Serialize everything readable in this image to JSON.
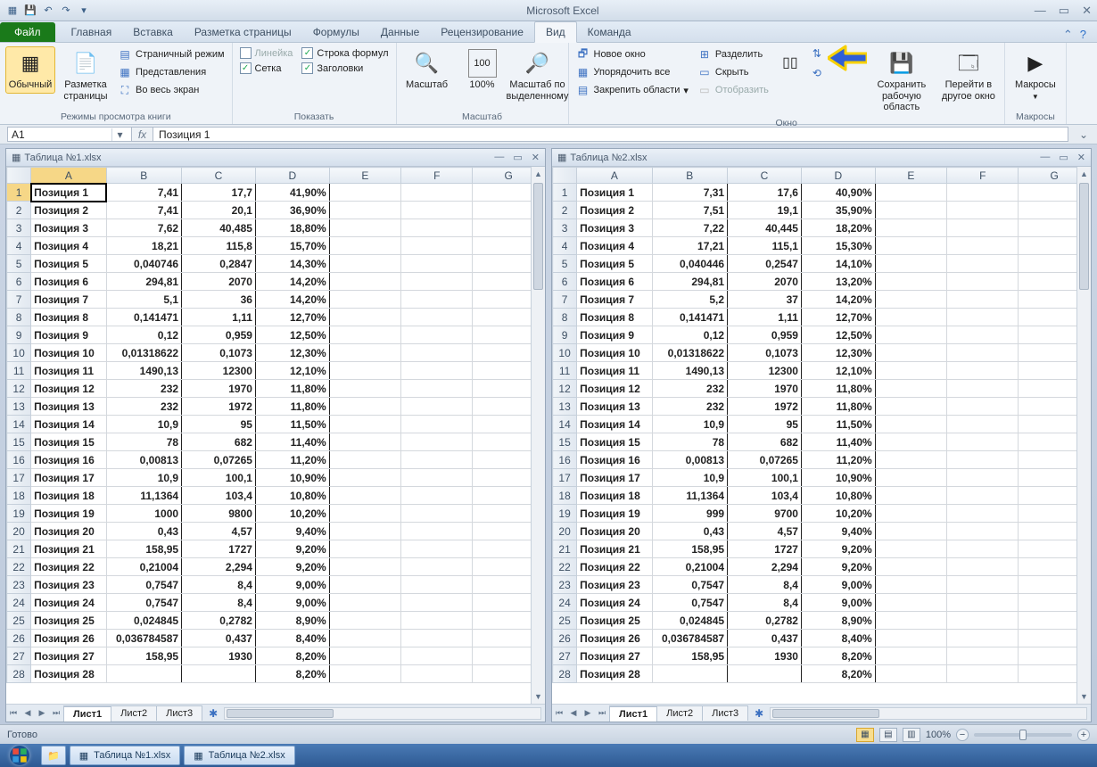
{
  "app_title": "Microsoft Excel",
  "quick_access": [
    "💾",
    "↶",
    "↷"
  ],
  "ribbon": {
    "file": "Файл",
    "tabs": [
      "Главная",
      "Вставка",
      "Разметка страницы",
      "Формулы",
      "Данные",
      "Рецензирование",
      "Вид",
      "Команда"
    ],
    "active_tab": "Вид",
    "groups": {
      "views": {
        "title": "Режимы просмотра книги",
        "normal": "Обычный",
        "page_layout": "Разметка\nстраницы",
        "page_break": "Страничный режим",
        "custom_views": "Представления",
        "fullscreen": "Во весь экран"
      },
      "show": {
        "title": "Показать",
        "ruler": "Линейка",
        "gridlines": "Сетка",
        "formula_bar": "Строка формул",
        "headings": "Заголовки"
      },
      "zoom": {
        "title": "Масштаб",
        "zoom": "Масштаб",
        "hundred": "100%",
        "selection": "Масштаб по\nвыделенному"
      },
      "window": {
        "title": "Окно",
        "new_window": "Новое окно",
        "arrange": "Упорядочить все",
        "freeze": "Закрепить области",
        "split": "Разделить",
        "hide": "Скрыть",
        "unhide": "Отобразить",
        "save_ws": "Сохранить\nрабочую область",
        "switch": "Перейти в\nдругое окно"
      },
      "macros": {
        "title": "Макросы",
        "label": "Макросы"
      }
    }
  },
  "namebox": "A1",
  "formula": "Позиция 1",
  "columns": [
    "A",
    "B",
    "C",
    "D",
    "E",
    "F",
    "G"
  ],
  "sheet_tabs": [
    "Лист1",
    "Лист2",
    "Лист3"
  ],
  "window1": {
    "title": "Таблица №1.xlsx",
    "rows": [
      [
        "Позиция 1",
        "7,41",
        "17,7",
        "41,90%"
      ],
      [
        "Позиция 2",
        "7,41",
        "20,1",
        "36,90%"
      ],
      [
        "Позиция 3",
        "7,62",
        "40,485",
        "18,80%"
      ],
      [
        "Позиция 4",
        "18,21",
        "115,8",
        "15,70%"
      ],
      [
        "Позиция 5",
        "0,040746",
        "0,2847",
        "14,30%"
      ],
      [
        "Позиция 6",
        "294,81",
        "2070",
        "14,20%"
      ],
      [
        "Позиция 7",
        "5,1",
        "36",
        "14,20%"
      ],
      [
        "Позиция 8",
        "0,141471",
        "1,11",
        "12,70%"
      ],
      [
        "Позиция 9",
        "0,12",
        "0,959",
        "12,50%"
      ],
      [
        "Позиция 10",
        "0,01318622",
        "0,1073",
        "12,30%"
      ],
      [
        "Позиция 11",
        "1490,13",
        "12300",
        "12,10%"
      ],
      [
        "Позиция 12",
        "232",
        "1970",
        "11,80%"
      ],
      [
        "Позиция 13",
        "232",
        "1972",
        "11,80%"
      ],
      [
        "Позиция 14",
        "10,9",
        "95",
        "11,50%"
      ],
      [
        "Позиция 15",
        "78",
        "682",
        "11,40%"
      ],
      [
        "Позиция 16",
        "0,00813",
        "0,07265",
        "11,20%"
      ],
      [
        "Позиция 17",
        "10,9",
        "100,1",
        "10,90%"
      ],
      [
        "Позиция 18",
        "11,1364",
        "103,4",
        "10,80%"
      ],
      [
        "Позиция 19",
        "1000",
        "9800",
        "10,20%"
      ],
      [
        "Позиция 20",
        "0,43",
        "4,57",
        "9,40%"
      ],
      [
        "Позиция 21",
        "158,95",
        "1727",
        "9,20%"
      ],
      [
        "Позиция 22",
        "0,21004",
        "2,294",
        "9,20%"
      ],
      [
        "Позиция 23",
        "0,7547",
        "8,4",
        "9,00%"
      ],
      [
        "Позиция 24",
        "0,7547",
        "8,4",
        "9,00%"
      ],
      [
        "Позиция 25",
        "0,024845",
        "0,2782",
        "8,90%"
      ],
      [
        "Позиция 26",
        "0,036784587",
        "0,437",
        "8,40%"
      ],
      [
        "Позиция 27",
        "158,95",
        "1930",
        "8,20%"
      ],
      [
        "Позиция 28",
        "",
        "",
        "8,20%"
      ]
    ]
  },
  "window2": {
    "title": "Таблица №2.xlsx",
    "rows": [
      [
        "Позиция 1",
        "7,31",
        "17,6",
        "40,90%"
      ],
      [
        "Позиция 2",
        "7,51",
        "19,1",
        "35,90%"
      ],
      [
        "Позиция 3",
        "7,22",
        "40,445",
        "18,20%"
      ],
      [
        "Позиция 4",
        "17,21",
        "115,1",
        "15,30%"
      ],
      [
        "Позиция 5",
        "0,040446",
        "0,2547",
        "14,10%"
      ],
      [
        "Позиция 6",
        "294,81",
        "2070",
        "13,20%"
      ],
      [
        "Позиция 7",
        "5,2",
        "37",
        "14,20%"
      ],
      [
        "Позиция 8",
        "0,141471",
        "1,11",
        "12,70%"
      ],
      [
        "Позиция 9",
        "0,12",
        "0,959",
        "12,50%"
      ],
      [
        "Позиция 10",
        "0,01318622",
        "0,1073",
        "12,30%"
      ],
      [
        "Позиция 11",
        "1490,13",
        "12300",
        "12,10%"
      ],
      [
        "Позиция 12",
        "232",
        "1970",
        "11,80%"
      ],
      [
        "Позиция 13",
        "232",
        "1972",
        "11,80%"
      ],
      [
        "Позиция 14",
        "10,9",
        "95",
        "11,50%"
      ],
      [
        "Позиция 15",
        "78",
        "682",
        "11,40%"
      ],
      [
        "Позиция 16",
        "0,00813",
        "0,07265",
        "11,20%"
      ],
      [
        "Позиция 17",
        "10,9",
        "100,1",
        "10,90%"
      ],
      [
        "Позиция 18",
        "11,1364",
        "103,4",
        "10,80%"
      ],
      [
        "Позиция 19",
        "999",
        "9700",
        "10,20%"
      ],
      [
        "Позиция 20",
        "0,43",
        "4,57",
        "9,40%"
      ],
      [
        "Позиция 21",
        "158,95",
        "1727",
        "9,20%"
      ],
      [
        "Позиция 22",
        "0,21004",
        "2,294",
        "9,20%"
      ],
      [
        "Позиция 23",
        "0,7547",
        "8,4",
        "9,00%"
      ],
      [
        "Позиция 24",
        "0,7547",
        "8,4",
        "9,00%"
      ],
      [
        "Позиция 25",
        "0,024845",
        "0,2782",
        "8,90%"
      ],
      [
        "Позиция 26",
        "0,036784587",
        "0,437",
        "8,40%"
      ],
      [
        "Позиция 27",
        "158,95",
        "1930",
        "8,20%"
      ],
      [
        "Позиция 28",
        "",
        "",
        "8,20%"
      ]
    ]
  },
  "status": {
    "ready": "Готово",
    "zoom": "100%"
  },
  "taskbar": {
    "items": [
      "Таблица №1.xlsx",
      "Таблица №2.xlsx"
    ]
  }
}
